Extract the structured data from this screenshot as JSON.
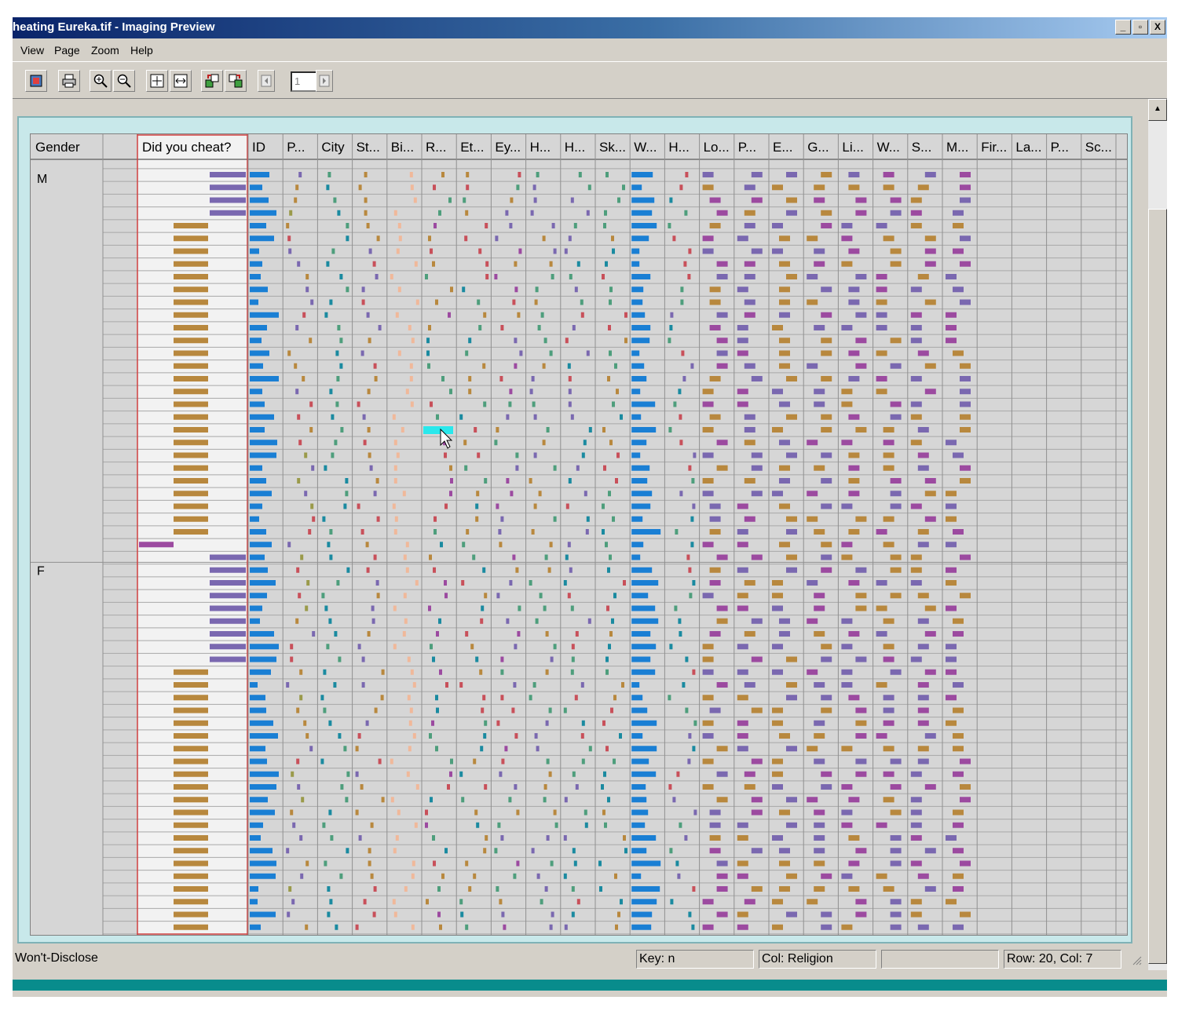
{
  "window": {
    "title": "heating Eureka.tif - Imaging Preview",
    "controls": [
      "_",
      "▫",
      "X"
    ]
  },
  "menu": [
    "View",
    "Page",
    "Zoom",
    "Help"
  ],
  "toolbar": {
    "buttons": [
      "open-image-icon",
      "print-icon",
      "zoom-in-icon",
      "zoom-out-icon",
      "fit-page-icon",
      "fit-width-icon",
      "rotate-left-icon",
      "rotate-right-icon",
      "previous-page-icon",
      "next-page-icon"
    ],
    "page_number": "1"
  },
  "grid": {
    "group_column": "Gender",
    "groups": [
      {
        "label": "M",
        "rows": 30
      },
      {
        "label": "F",
        "rows": 31
      }
    ],
    "sorted_column": "Did you cheat?",
    "columns": [
      "ID",
      "P...",
      "City",
      "St...",
      "Bi...",
      "R...",
      "Et...",
      "Ey...",
      "H...",
      "H...",
      "Sk...",
      "W...",
      "H...",
      "Lo...",
      "P...",
      "E...",
      "G...",
      "Li...",
      "W...",
      "S...",
      "M...",
      "Fir...",
      "La...",
      "P...",
      "Sc..."
    ],
    "colors": {
      "blue": "#1a7fd4",
      "purple": "#7a68b0",
      "tan": "#b8883e",
      "orange": "#f0b89a",
      "red": "#c8505a",
      "green": "#4e9e7c",
      "teal": "#1a8aa0",
      "magenta": "#9c4aa0",
      "olive": "#9a9a4a",
      "highlight": "#29e8ec"
    }
  },
  "statusbar": {
    "value": "Won't-Disclose",
    "key": "Key: n",
    "column": "Col: Religion",
    "blank": "",
    "position": "Row: 20, Col: 7"
  }
}
